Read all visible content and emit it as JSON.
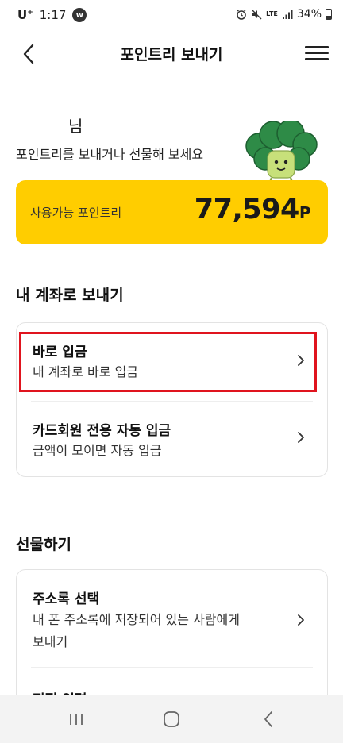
{
  "status_bar": {
    "carrier": "U",
    "carrier_sup": "+",
    "time": "1:17",
    "app_icon_letter": "w",
    "lte": "LTE",
    "battery": "34%"
  },
  "header": {
    "title": "포인트리 보내기"
  },
  "greeting": {
    "name_suffix": "님",
    "subtitle": "포인트리를 보내거나 선물해 보세요"
  },
  "points_card": {
    "label": "사용가능 포인트리",
    "value": "77,594",
    "unit": "P"
  },
  "send_section": {
    "title": "내 계좌로 보내기",
    "items": [
      {
        "title": "바로 입금",
        "desc": "내 계좌로 바로 입금"
      },
      {
        "title": "카드회원 전용 자동 입금",
        "desc": "금액이 모이면 자동 입금"
      }
    ]
  },
  "gift_section": {
    "title": "선물하기",
    "items": [
      {
        "title": "주소록 선택",
        "desc_line1": "내 폰 주소록에 저장되어 있는 사람에게",
        "desc_line2": "보내기"
      },
      {
        "title": "직접 입력"
      }
    ]
  },
  "colors": {
    "accent_yellow": "#ffcd00",
    "highlight_red": "#e0141e",
    "mascot_green": "#2e8b47"
  },
  "icons": [
    "back-arrow-icon",
    "menu-icon",
    "chevron-right-icon",
    "recent-apps-icon",
    "home-icon",
    "nav-back-icon",
    "alarm-icon",
    "mute-icon",
    "signal-icon",
    "battery-icon"
  ]
}
